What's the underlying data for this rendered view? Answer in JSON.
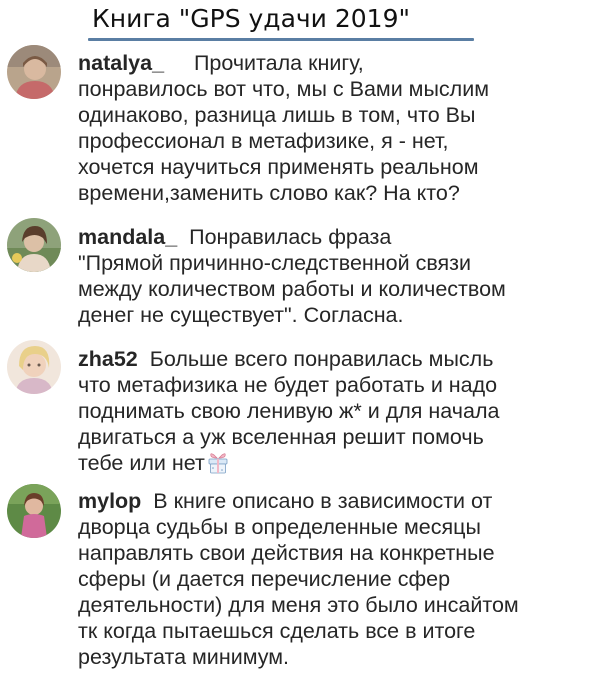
{
  "title": "Книга \"GPS удачи 2019\"",
  "comments": [
    {
      "username": "natalya_",
      "lines": [
        "Прочитала книгу,",
        "понравилось вот что, мы с Вами мыслим",
        "одинаково, разница лишь в том, что Вы",
        "профессионал в метафизике, я - нет,",
        "хочется научиться применять реальном",
        "времени,заменить слово как? На кто?"
      ]
    },
    {
      "username": "mandala_",
      "lines": [
        "Понравилась фраза",
        "\"Прямой причинно-следственной связи",
        "между количеством работы и количеством",
        "денег не существует\". Согласна."
      ]
    },
    {
      "username": "zha52",
      "lines": [
        "Больше всего понравилась мысль",
        "что метафизика не будет работать и надо",
        "поднимать свою ленивую ж* и для начала",
        "двигаться а уж вселенная решит помочь",
        "тебе или нет"
      ],
      "emoji": "gift-emoji"
    },
    {
      "username": "mylop",
      "lines": [
        "В книге описано в зависимости от",
        "дворца судьбы в определенные месяцы",
        "направлять свои действия на конкретные",
        "сферы (и дается перечисление сфер",
        "деятельности) для меня это было инсайтом",
        "тк когда пытаешься сделать все в итоге",
        "результата минимум."
      ]
    }
  ]
}
